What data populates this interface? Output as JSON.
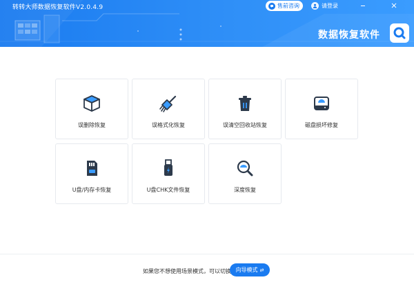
{
  "app": {
    "title": "转转大师数据恢复软件V2.0.4.9",
    "brand": "数据恢复软件"
  },
  "header": {
    "consult_label": "售前咨询",
    "login_label": "请登录"
  },
  "modes": [
    {
      "label": "误删除恢复",
      "icon": "box-icon"
    },
    {
      "label": "误格式化恢复",
      "icon": "broom-icon"
    },
    {
      "label": "误清空回收站恢复",
      "icon": "trash-icon"
    },
    {
      "label": "磁盘损坏修复",
      "icon": "disk-icon"
    },
    {
      "label": "U盘/内存卡恢复",
      "icon": "sdcard-icon"
    },
    {
      "label": "U盘CHK文件恢复",
      "icon": "usb-icon"
    },
    {
      "label": "深度恢复",
      "icon": "magnifier-icon"
    }
  ],
  "footer": {
    "hint": "如果您不想使用场景模式，可以切换至",
    "guide_label": "向导模式"
  },
  "colors": {
    "accent": "#1a7bf0",
    "icon_blue": "#3a9cff",
    "icon_dark": "#2d3a4b"
  }
}
